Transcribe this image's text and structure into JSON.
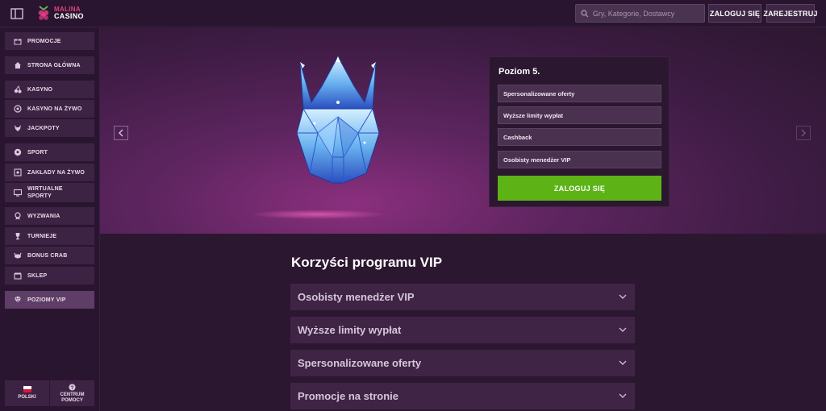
{
  "header": {
    "logo_line1": "MALINA",
    "logo_line2": "CASINO",
    "search_placeholder": "Gry, Kategorie, Dostawcy",
    "login_label": "ZALOGUJ SIĘ",
    "register_label": "ZAREJESTRUJ"
  },
  "sidebar": {
    "items": [
      {
        "label": "PROMOCJE",
        "icon": "gift-icon"
      },
      {
        "label": "STRONA GŁÓWNA",
        "icon": "home-icon"
      },
      {
        "label": "KASYNO",
        "icon": "cherries-icon"
      },
      {
        "label": "KASYNO NA ŻYWO",
        "icon": "roulette-icon"
      },
      {
        "label": "JACKPOTY",
        "icon": "fox-icon"
      },
      {
        "label": "SPORT",
        "icon": "soccer-ball-icon"
      },
      {
        "label": "ZAKŁADY NA ŻYWO",
        "icon": "live-bet-icon"
      },
      {
        "label_line1": "WIRTUALNE",
        "label_line2": "SPORTY",
        "icon": "virtual-sports-icon"
      },
      {
        "label": "WYZWANIA",
        "icon": "medal-icon"
      },
      {
        "label": "TURNIEJE",
        "icon": "trophy-icon"
      },
      {
        "label": "BONUS CRAB",
        "icon": "crab-icon"
      },
      {
        "label": "SKLEP",
        "icon": "shop-icon"
      },
      {
        "label": "POZIOMY VIP",
        "icon": "diamond-icon"
      }
    ],
    "language_label": "POLSKI",
    "help_line1": "CENTRUM",
    "help_line2": "POMOCY"
  },
  "hero": {
    "level_title": "Poziom 5.",
    "benefits": [
      "Spersonalizowane oferty",
      "Wyższe limity wypłat",
      "Cashback",
      "Osobisty menedżer VIP"
    ],
    "login_button": "ZALOGUJ SIĘ"
  },
  "vip": {
    "title": "Korzyści programu VIP",
    "accordion": [
      "Osobisty menedżer VIP",
      "Wyższe limity wypłat",
      "Spersonalizowane oferty",
      "Promocje na stronie"
    ]
  },
  "colors": {
    "accent_green": "#5db315",
    "brand_pink": "#e0407e",
    "background": "#2c1730"
  }
}
